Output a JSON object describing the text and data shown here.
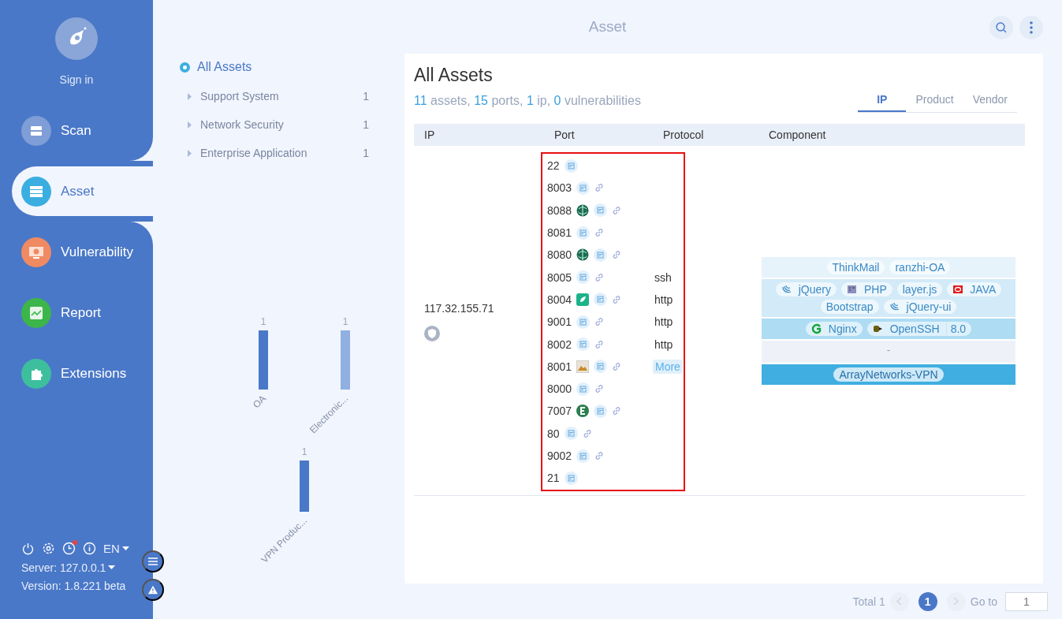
{
  "sidebar": {
    "sign_in": "Sign in",
    "nav": [
      {
        "label": "Scan",
        "kind": "scan",
        "color": "#7f9dd6",
        "selected": false
      },
      {
        "label": "Asset",
        "kind": "asset",
        "color": "#3aaee0",
        "selected": true
      },
      {
        "label": "Vulnerability",
        "kind": "bug",
        "color": "#f08a62",
        "selected": false
      },
      {
        "label": "Report",
        "kind": "chart",
        "color": "#3cb54a",
        "selected": false
      },
      {
        "label": "Extensions",
        "kind": "puzzle",
        "color": "#3dbf9e",
        "selected": false
      }
    ],
    "tools": [
      {
        "kind": "power"
      },
      {
        "kind": "settings"
      },
      {
        "kind": "history",
        "badge": true
      },
      {
        "kind": "info"
      }
    ],
    "language": "EN",
    "server": "Server: 127.0.0.1",
    "version": "Version: 1.8.221 beta"
  },
  "header": {
    "title": "Asset"
  },
  "tree": {
    "label": "All Assets",
    "selected": true,
    "children": [
      {
        "label": "Support System",
        "count": "1",
        "expanded": false
      },
      {
        "label": "Network Security",
        "count": "1",
        "expanded": false
      },
      {
        "label": "Enterprise Application",
        "count": "1",
        "expanded": false
      }
    ]
  },
  "charts": [
    {
      "chart_data": {
        "type": "bar",
        "categories": [
          "OA",
          "Electronic..."
        ],
        "values": [
          1,
          1
        ],
        "data_labels": true
      }
    },
    {
      "chart_data": {
        "type": "bar",
        "categories": [
          "VPN Produc..."
        ],
        "values": [
          1
        ],
        "data_labels": true
      }
    }
  ],
  "panel": {
    "title": "All Assets",
    "summary": [
      {
        "count": "11",
        "label": "assets,"
      },
      {
        "count": "15",
        "label": "ports,"
      },
      {
        "count": "1",
        "label": "ip,"
      },
      {
        "count": "0",
        "label": "vulnerabilities"
      }
    ],
    "tabs": [
      {
        "label": "IP",
        "selected": true
      },
      {
        "label": "Product",
        "selected": false
      },
      {
        "label": "Vendor",
        "selected": false
      }
    ],
    "table": {
      "columns": [
        "IP",
        "Port",
        "Protocol",
        "Component"
      ],
      "rows": [
        {
          "ip": "117.32.155.71",
          "ports_highlighted": true,
          "ports": [
            {
              "port": "22",
              "link": false
            },
            {
              "port": "8003",
              "link": true
            },
            {
              "port": "8088",
              "kind": "globe",
              "link": true
            },
            {
              "port": "8081",
              "link": true
            },
            {
              "port": "8080",
              "kind": "globe",
              "link": true
            },
            {
              "port": "8005",
              "link": true,
              "protocol": "ssh"
            },
            {
              "port": "8004",
              "kind": "leaf",
              "link": true,
              "protocol": "http"
            },
            {
              "port": "9001",
              "link": true,
              "protocol": "http"
            },
            {
              "port": "8002",
              "link": true,
              "protocol": "http"
            },
            {
              "port": "8001",
              "kind": "photo",
              "link": true,
              "more": "More"
            },
            {
              "port": "8000",
              "link": true
            },
            {
              "port": "7007",
              "kind": "e",
              "link": true
            },
            {
              "port": "80",
              "link": true
            },
            {
              "port": "9002",
              "link": true
            },
            {
              "port": "21",
              "link": false
            }
          ],
          "components": [
            {
              "color": "#e6f3fb",
              "tags": [
                {
                  "label": "ThinkMail"
                },
                {
                  "label": "ranzhi-OA"
                }
              ]
            },
            {
              "color": "#d3eaf8",
              "tags": [
                {
                  "label": "jQuery",
                  "kind": "jquery"
                },
                {
                  "label": "PHP",
                  "kind": "php"
                },
                {
                  "label": "layer.js"
                },
                {
                  "label": "JAVA",
                  "kind": "java"
                },
                {
                  "label": "Bootstrap"
                },
                {
                  "label": "jQuery-ui",
                  "kind": "jquery"
                }
              ]
            },
            {
              "color": "#addcf3",
              "tags": [
                {
                  "label": "Nginx",
                  "kind": "nginx"
                },
                {
                  "label": "OpenSSH",
                  "kind": "plug",
                  "version": "8.0"
                }
              ]
            },
            {
              "color": "#eef2f8",
              "text": "-"
            },
            {
              "color": "#40aee0",
              "tags": [
                {
                  "label": "ArrayNetworks-VPN"
                }
              ]
            }
          ]
        }
      ]
    }
  },
  "pagination": {
    "total": "Total 1",
    "prev_disabled": true,
    "next_disabled": true,
    "pages": [
      {
        "label": "1",
        "selected": true
      }
    ],
    "goto_label": "Go to",
    "goto_value": "1"
  }
}
